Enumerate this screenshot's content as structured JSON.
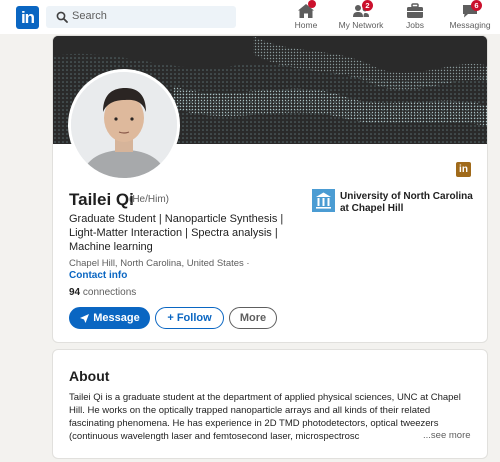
{
  "nav": {
    "logo_text": "in",
    "search": {
      "placeholder": "Search",
      "icon": "search-icon"
    },
    "items": [
      {
        "label": "Home",
        "icon": "home-icon",
        "badge": ""
      },
      {
        "label": "My Network",
        "icon": "network-icon",
        "badge": "2"
      },
      {
        "label": "Jobs",
        "icon": "briefcase-icon",
        "badge": ""
      },
      {
        "label": "Messaging",
        "icon": "chat-icon",
        "badge": "6"
      }
    ]
  },
  "profile": {
    "name": "Tailei Qi",
    "pronouns": "(He/Him)",
    "headline": "Graduate Student | Nanoparticle Synthesis | Light-Matter Interaction | Spectra analysis | Machine learning",
    "location": "Chapel Hill, North Carolina, United States ·",
    "contact_label": "Contact info",
    "connections_count": "94",
    "connections_label": "connections",
    "school": "University of North Carolina at Chapel Hill",
    "premium_badge": "in",
    "buttons": {
      "message": "Message",
      "follow": "+ Follow",
      "more": "More"
    }
  },
  "about": {
    "title": "About",
    "text": "Tailei Qi is a graduate student at the department of applied physical sciences, UNC at Chapel Hill. He works on the optically trapped nanoparticle arrays and all kinds of their related fascinating phenomena. He has experience in 2D TMD photodetectors, optical tweezers (continuous wavelength laser and femtosecond laser, microspectrosc",
    "see_more": "...see more"
  },
  "colors": {
    "brand": "#0a66c2",
    "badge": "#cb112d",
    "page_bg": "#f3f2ef",
    "cover_bg": "#2c2c2c",
    "school_logo": "#4b9cd3"
  }
}
